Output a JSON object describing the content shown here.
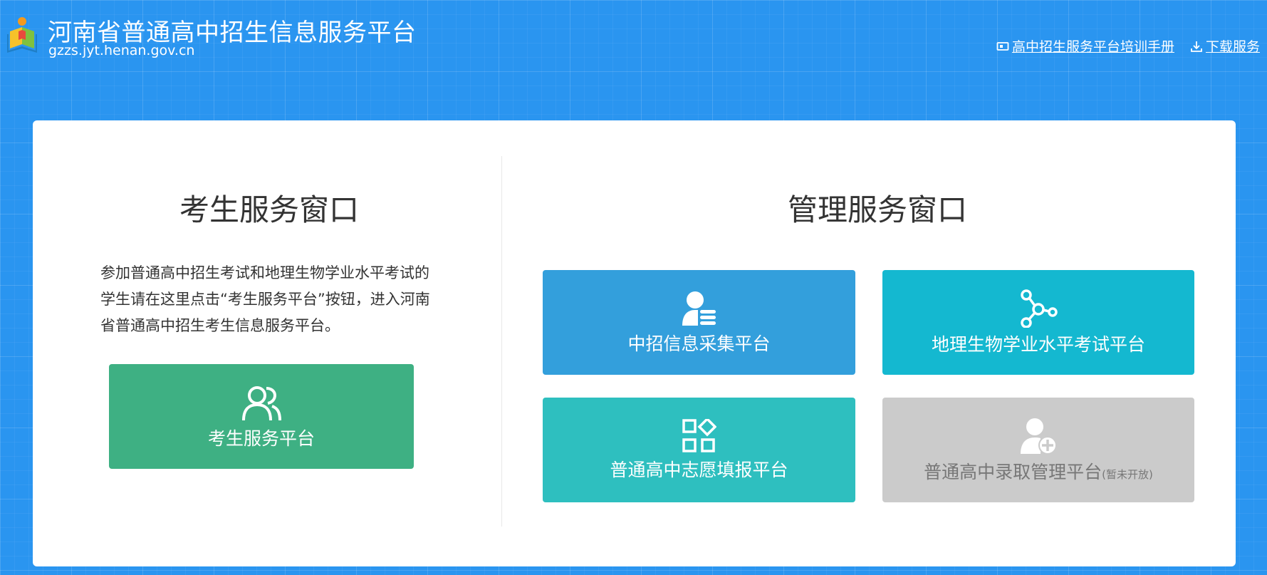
{
  "header": {
    "title": "河南省普通高中招生信息服务平台",
    "domain": "gzzs.jyt.henan.gov.cn",
    "links": {
      "manual": "高中招生服务平台培训手册",
      "download": "下载服务"
    }
  },
  "student_window": {
    "title": "考生服务窗口",
    "intro": "参加普通高中招生考试和地理生物学业水平考试的学生请在这里点击“考生服务平台”按钮，进入河南省普通高中招生考生信息服务平台。",
    "button_label": "考生服务平台"
  },
  "admin_window": {
    "title": "管理服务窗口",
    "tiles": {
      "collect": "中招信息采集平台",
      "geo_bio": "地理生物学业水平考试平台",
      "volunteer": "普通高中志愿填报平台",
      "admission": "普通高中录取管理平台",
      "admission_note": "(暂未开放)"
    }
  },
  "colors": {
    "background": "#2a95f0",
    "student_green": "#3eb083",
    "collect_blue": "#339fdc",
    "geo_cyan": "#14b8d0",
    "volunteer_teal": "#2ebfbf",
    "disabled_gray": "#cbcbcb"
  },
  "icons": {
    "logo": "book-with-person-logo",
    "manual": "monitor-icon",
    "download": "download-icon",
    "student": "users-icon",
    "collect": "user-list-icon",
    "geo_bio": "molecule-icon",
    "volunteer": "grid-diamond-icon",
    "admission": "user-add-icon"
  }
}
